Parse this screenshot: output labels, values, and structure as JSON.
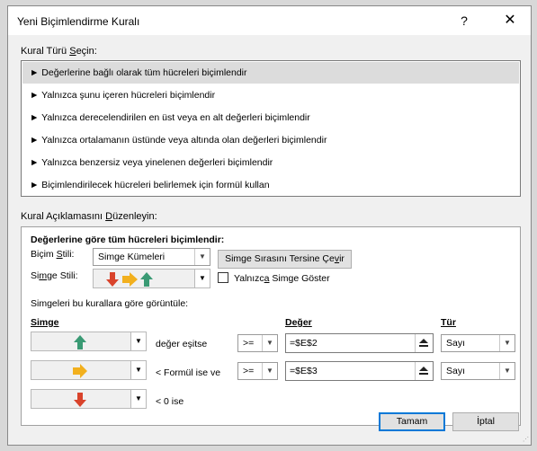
{
  "dialog": {
    "title": "Yeni Biçimlendirme Kuralı",
    "help": "?",
    "close": "✕"
  },
  "rule_type": {
    "label_before": "Kural Türü ",
    "label_underline": "S",
    "label_after": "eçin:",
    "items": [
      "► Değerlerine bağlı olarak tüm hücreleri biçimlendir",
      "► Yalnızca şunu içeren hücreleri biçimlendir",
      "► Yalnızca derecelendirilen en üst veya en alt değerleri biçimlendir",
      "► Yalnızca ortalamanın üstünde veya altında olan değerleri biçimlendir",
      "► Yalnızca benzersiz veya yinelenen değerleri biçimlendir",
      "► Biçimlendirilecek hücreleri belirlemek için formül kullan"
    ],
    "selected_index": 0
  },
  "description": {
    "label_before": "Kural Açıklamasını ",
    "label_underline": "D",
    "label_after": "üzenleyin:",
    "heading": "Değerlerine göre tüm hücreleri biçimlendir:",
    "format_style_label_before": "Biçim ",
    "format_style_label_underline": "S",
    "format_style_label_after": "tili:",
    "format_style_value": "Simge Kümeleri",
    "reverse_button_before": "Simge Sırasını Tersine Çe",
    "reverse_button_underline": "v",
    "reverse_button_after": "ir",
    "icon_style_label_before": "Si",
    "icon_style_label_underline": "m",
    "icon_style_label_after": "ge Stili:",
    "show_icon_only_before": "Yalnızc",
    "show_icon_only_underline": "a",
    "show_icon_only_after": " Simge Göster",
    "show_icon_only_checked": false,
    "rules_caption": "Simgeleri bu kurallara göre görüntüle:",
    "col_icon": "Simge",
    "col_value": "Değer",
    "col_type": "Tür",
    "rows": [
      {
        "icon": "up-arrow-icon",
        "icon_color": "#3a9a74",
        "condition": "değer eşitse",
        "operator": ">=",
        "value": "=$E$2",
        "type": "Sayı"
      },
      {
        "icon": "right-arrow-icon",
        "icon_color": "#f2b01e",
        "condition": "< Formül ise ve",
        "operator": ">=",
        "value": "=$E$3",
        "type": "Sayı"
      },
      {
        "icon": "down-arrow-icon",
        "icon_color": "#d9432b",
        "condition": "< 0 ise"
      }
    ]
  },
  "buttons": {
    "ok": "Tamam",
    "cancel": "İptal"
  }
}
